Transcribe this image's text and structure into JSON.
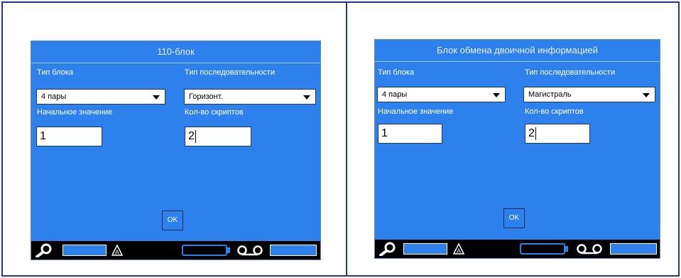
{
  "left": {
    "title": "110-блок",
    "block_type_label": "Тип блока",
    "block_type_value": "4 пары",
    "sequence_type_label": "Тип последовательности",
    "sequence_type_value": "Горизонт.",
    "start_value_label": "Начальное значение",
    "start_value": "1",
    "terminal_count_label": "Кол-во скриптов",
    "terminal_count": "2",
    "ok_label": "OK"
  },
  "right": {
    "title": "Блок обмена двоичной информацией",
    "block_type_label": "Тип блока",
    "block_type_value": "4 пары",
    "sequence_type_label": "Тип последовательности",
    "sequence_type_value": "Магистраль",
    "start_value_label": "Начальное значение",
    "start_value": "1",
    "terminal_count_label": "Кол-во скриптов",
    "terminal_count": "2",
    "ok_label": "OK"
  },
  "colors": {
    "screen_blue": "#2e80ec",
    "frame_border": "#1f3a93",
    "bottom_bar": "#000000"
  },
  "icons": [
    "search-icon",
    "font-icon",
    "battery-icon",
    "label-roll-icon"
  ]
}
